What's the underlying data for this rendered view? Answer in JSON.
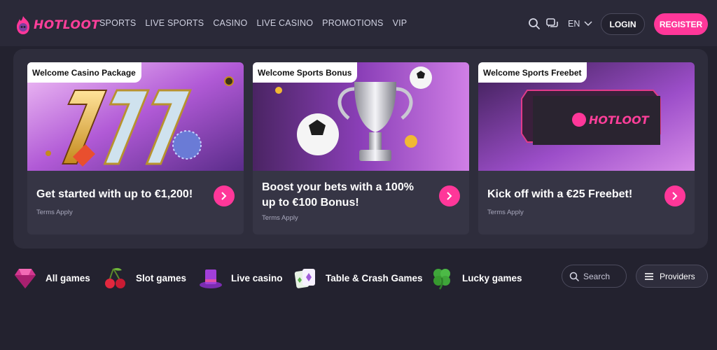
{
  "header": {
    "logo_text": "HOTLOOT",
    "nav": [
      "SPORTS",
      "LIVE SPORTS",
      "CASINO",
      "LIVE CASINO",
      "PROMOTIONS",
      "VIP"
    ],
    "language": "EN",
    "login_label": "LOGIN",
    "register_label": "REGISTER"
  },
  "promos": [
    {
      "tag": "Welcome Casino Package",
      "title": "Get started with up to €1,200!",
      "terms": "Terms Apply"
    },
    {
      "tag": "Welcome Sports Bonus",
      "title": "Boost your bets with a 100% up to €100 Bonus!",
      "terms": "Terms Apply"
    },
    {
      "tag": "Welcome Sports Freebet",
      "title": "Kick off with a €25 Freebet!",
      "terms": "Terms Apply",
      "banner_logo_text": "HOTLOOT"
    }
  ],
  "categories": [
    {
      "label": "All games",
      "icon": "gem-icon"
    },
    {
      "label": "Slot games",
      "icon": "cherries-icon"
    },
    {
      "label": "Live casino",
      "icon": "top-hat-icon"
    },
    {
      "label": "Table & Crash Games",
      "icon": "cards-icon"
    },
    {
      "label": "Lucky games",
      "icon": "clover-icon"
    }
  ],
  "search": {
    "placeholder": "Search"
  },
  "providers_label": "Providers",
  "colors": {
    "accent": "#ff3799",
    "background": "#23222f",
    "header": "#2a2938",
    "card": "#363545"
  }
}
